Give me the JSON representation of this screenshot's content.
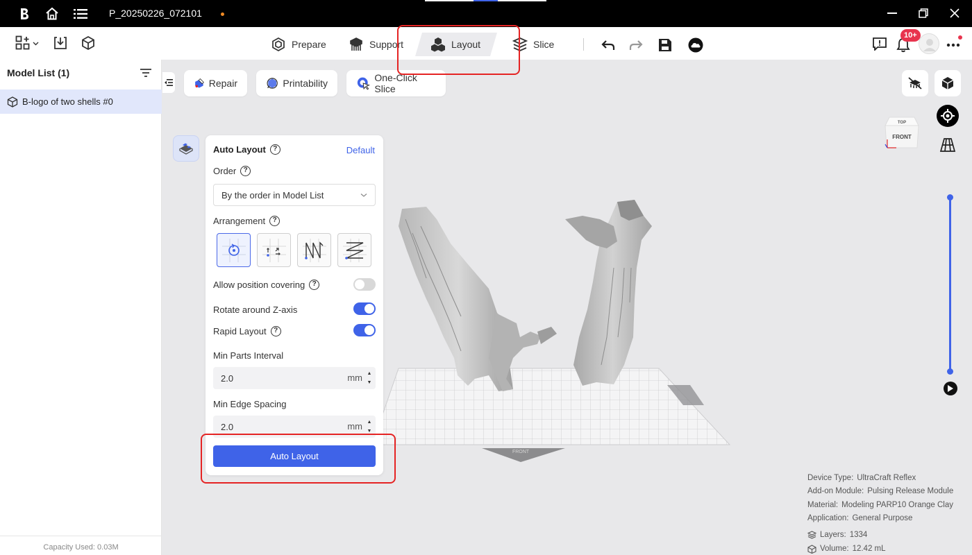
{
  "titlebar": {
    "filename": "P_20250226_072101"
  },
  "tabs": [
    {
      "id": "prepare",
      "label": "Prepare"
    },
    {
      "id": "support",
      "label": "Support"
    },
    {
      "id": "layout",
      "label": "Layout"
    },
    {
      "id": "slice",
      "label": "Slice"
    }
  ],
  "notifications": {
    "badge": "10+"
  },
  "sidebar": {
    "title": "Model List (1)",
    "item": "B-logo of two shells #0",
    "capacity": "Capacity Used: 0.03M"
  },
  "viewport_toolbar": {
    "repair": "Repair",
    "printability": "Printability",
    "one_click_slice": "One-Click Slice"
  },
  "view_cube": {
    "top": "TOP",
    "front": "FRONT"
  },
  "plate_label": "FRONT",
  "panel": {
    "title": "Auto Layout",
    "default_link": "Default",
    "order_label": "Order",
    "order_value": "By the order in Model List",
    "arrangement_label": "Arrangement",
    "allow_covering": "Allow position covering",
    "rotate_z": "Rotate around Z-axis",
    "rapid_layout": "Rapid Layout",
    "min_parts_label": "Min Parts Interval",
    "min_parts_value": "2.0",
    "min_edge_label": "Min Edge Spacing",
    "min_edge_value": "2.0",
    "unit": "mm",
    "button": "Auto Layout",
    "toggles": {
      "allow_covering": false,
      "rotate_z": true,
      "rapid_layout": true
    }
  },
  "info": {
    "device_type_label": "Device Type:",
    "device_type": "UltraCraft Reflex",
    "addon_label": "Add-on Module:",
    "addon": "Pulsing Release Module",
    "material_label": "Material:",
    "material": "Modeling PARP10 Orange Clay",
    "application_label": "Application:",
    "application": "General Purpose",
    "layers_label": "Layers:",
    "layers": "1334",
    "volume_label": "Volume:",
    "volume": "12.42 mL"
  },
  "colors": {
    "accent": "#3f63e8",
    "highlight_box": "#e52323",
    "badge": "#e8344e"
  }
}
